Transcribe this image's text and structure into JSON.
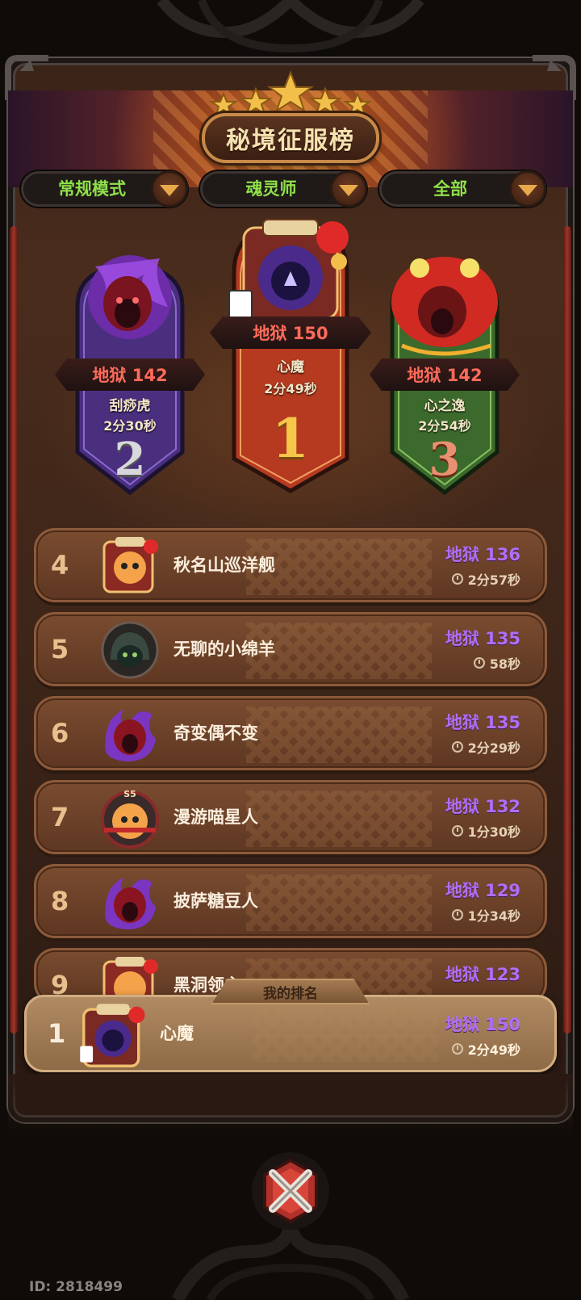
{
  "header": {
    "title": "秘境征服榜"
  },
  "filters": [
    {
      "label": "常规模式"
    },
    {
      "label": "魂灵师"
    },
    {
      "label": "全部"
    }
  ],
  "podium": [
    {
      "rank": "1",
      "score": "地狱 150",
      "name": "心魔",
      "time": "2分49秒",
      "color": "#c0462a"
    },
    {
      "rank": "2",
      "score": "地狱 142",
      "name": "刮痧虎",
      "time": "2分30秒",
      "color": "#5a3b8e"
    },
    {
      "rank": "3",
      "score": "地狱 142",
      "name": "心之逸",
      "time": "2分54秒",
      "color": "#3f6a32"
    }
  ],
  "leaderboard": [
    {
      "rank": "4",
      "name": "秋名山巡洋舰",
      "score": "地狱 136",
      "time": "2分57秒",
      "avatar": "circus-cat-avatar"
    },
    {
      "rank": "5",
      "name": "无聊的小绵羊",
      "score": "地狱 135",
      "time": "58秒",
      "avatar": "hooded-cat-avatar"
    },
    {
      "rank": "6",
      "name": "奇变偶不变",
      "score": "地狱 135",
      "time": "2分29秒",
      "avatar": "demon-flame-avatar"
    },
    {
      "rank": "7",
      "name": "漫游喵星人",
      "score": "地狱 132",
      "time": "1分30秒",
      "avatar": "s5-cat-avatar",
      "badge": "S5"
    },
    {
      "rank": "8",
      "name": "披萨糖豆人",
      "score": "地狱 129",
      "time": "1分34秒",
      "avatar": "demon-flame-avatar"
    },
    {
      "rank": "9",
      "name": "黑洞领主",
      "score": "地狱 123",
      "time": "",
      "avatar": "circus-cat-avatar"
    }
  ],
  "my_rank": {
    "tab_label": "我的排名",
    "rank": "1",
    "name": "心魔",
    "score": "地狱 150",
    "time": "2分49秒"
  },
  "footer": {
    "id_text": "ID: 2818499"
  },
  "colors": {
    "score_purple": "#b06ef5",
    "podium_score_red": "#ff6b5a",
    "filter_green": "#8fe04a"
  }
}
